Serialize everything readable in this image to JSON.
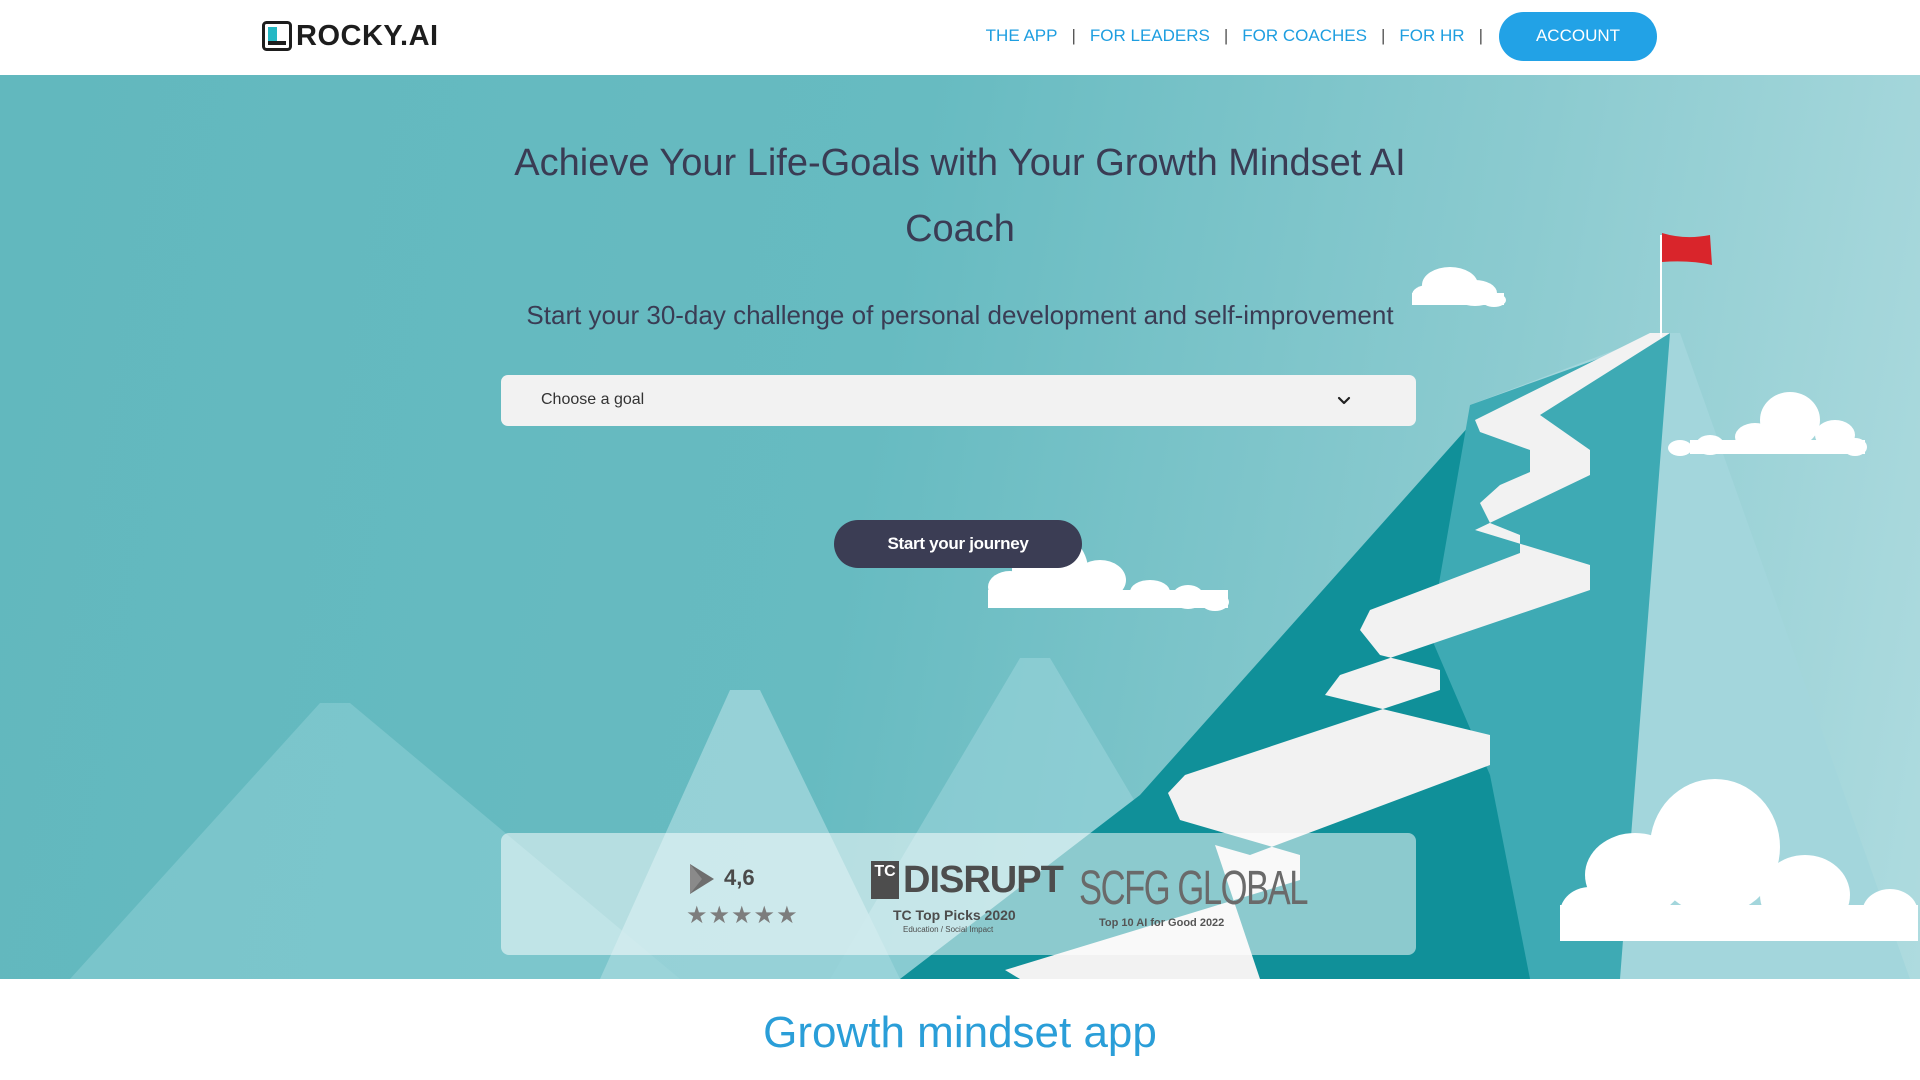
{
  "header": {
    "logo_text": "ROCKY.AI",
    "nav": [
      {
        "label": "THE APP"
      },
      {
        "label": "FOR LEADERS"
      },
      {
        "label": "FOR COACHES"
      },
      {
        "label": "FOR HR"
      }
    ],
    "separator": "|",
    "account_label": "ACCOUNT"
  },
  "hero": {
    "title": "Achieve Your Life-Goals with Your Growth Mindset AI Coach",
    "subtitle": "Start your 30-day challenge of personal development and self-improvement",
    "goal_select": {
      "value": "Choose a goal",
      "icon": "chevron-down-icon"
    },
    "cta_label": "Start your journey"
  },
  "badges": {
    "rating": {
      "value": "4,6",
      "stars": "★★★★★",
      "icon": "play-store-icon"
    },
    "disrupt": {
      "logo": "TC",
      "title": "DISRUPT",
      "subtitle": "TC Top Picks 2020",
      "caption": "Education / Social Impact"
    },
    "scfg": {
      "title": "SCFG GLOBAL",
      "subtitle": "Top 10 AI for Good 2022"
    }
  },
  "section": {
    "title": "Growth mindset app"
  },
  "colors": {
    "accent": "#22a2e6",
    "nav_link": "#1e9ee0",
    "hero_text": "#3a3c54",
    "cta_bg": "#3b3d54",
    "flag": "#d9252b",
    "mountain_dark": "#0f8d9a"
  }
}
